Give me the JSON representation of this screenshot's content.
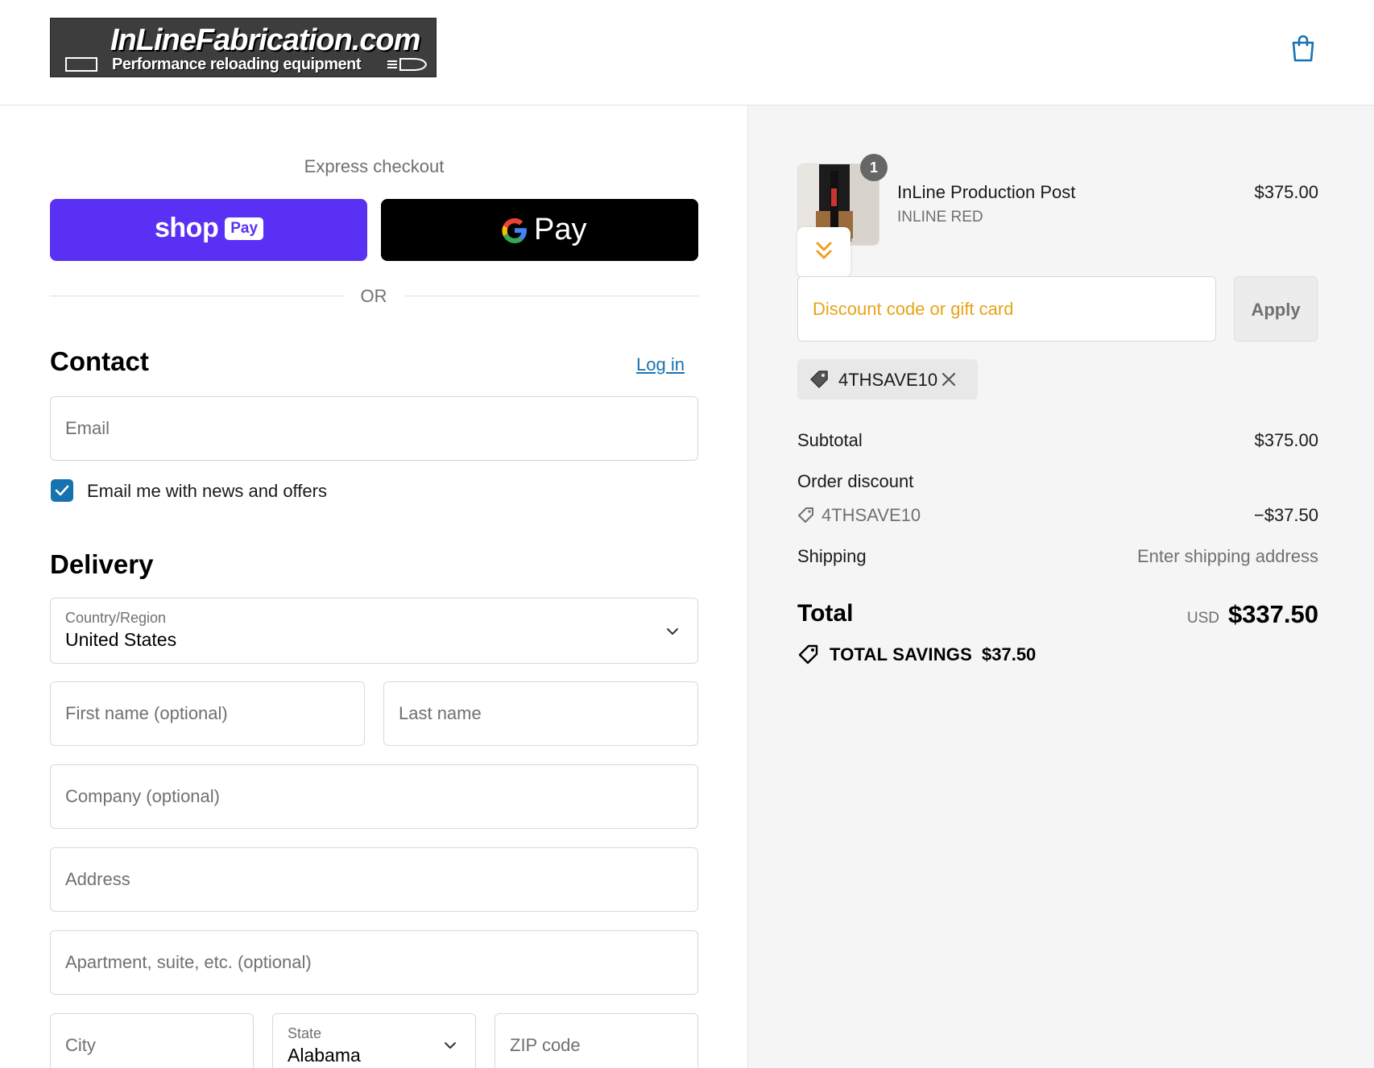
{
  "header": {
    "logo_title": "InLineFabrication.com",
    "logo_subtitle": "Performance reloading equipment",
    "cart_icon": "shopping-bag-icon"
  },
  "express": {
    "label": "Express checkout",
    "shop_pay_word": "shop",
    "shop_pay_badge": "Pay",
    "gpay_word": "Pay",
    "or_label": "OR"
  },
  "contact": {
    "title": "Contact",
    "login_label": "Log in",
    "email_placeholder": "Email",
    "news_checkbox_label": "Email me with news and offers",
    "news_checked": true
  },
  "delivery": {
    "title": "Delivery",
    "country_label": "Country/Region",
    "country_value": "United States",
    "first_name_placeholder": "First name (optional)",
    "last_name_placeholder": "Last name",
    "company_placeholder": "Company (optional)",
    "address_placeholder": "Address",
    "apartment_placeholder": "Apartment, suite, etc. (optional)",
    "city_placeholder": "City",
    "state_label": "State",
    "state_value": "Alabama",
    "zip_placeholder": "ZIP code"
  },
  "summary": {
    "item": {
      "quantity": "1",
      "title": "InLine Production Post",
      "variant": "INLINE RED",
      "price": "$375.00"
    },
    "discount_placeholder": "Discount code or gift card",
    "apply_label": "Apply",
    "applied_code": "4THSAVE10",
    "subtotal_label": "Subtotal",
    "subtotal_value": "$375.00",
    "order_discount_label": "Order discount",
    "discount_code_label": "4THSAVE10",
    "discount_value": "−$37.50",
    "shipping_label": "Shipping",
    "shipping_value": "Enter shipping address",
    "total_label": "Total",
    "total_currency": "USD",
    "total_value": "$337.50",
    "savings_label": "TOTAL SAVINGS",
    "savings_value": "$37.50"
  },
  "colors": {
    "shop_pay": "#5a31f4",
    "link": "#1773b0",
    "discount_placeholder": "#e8a317"
  }
}
